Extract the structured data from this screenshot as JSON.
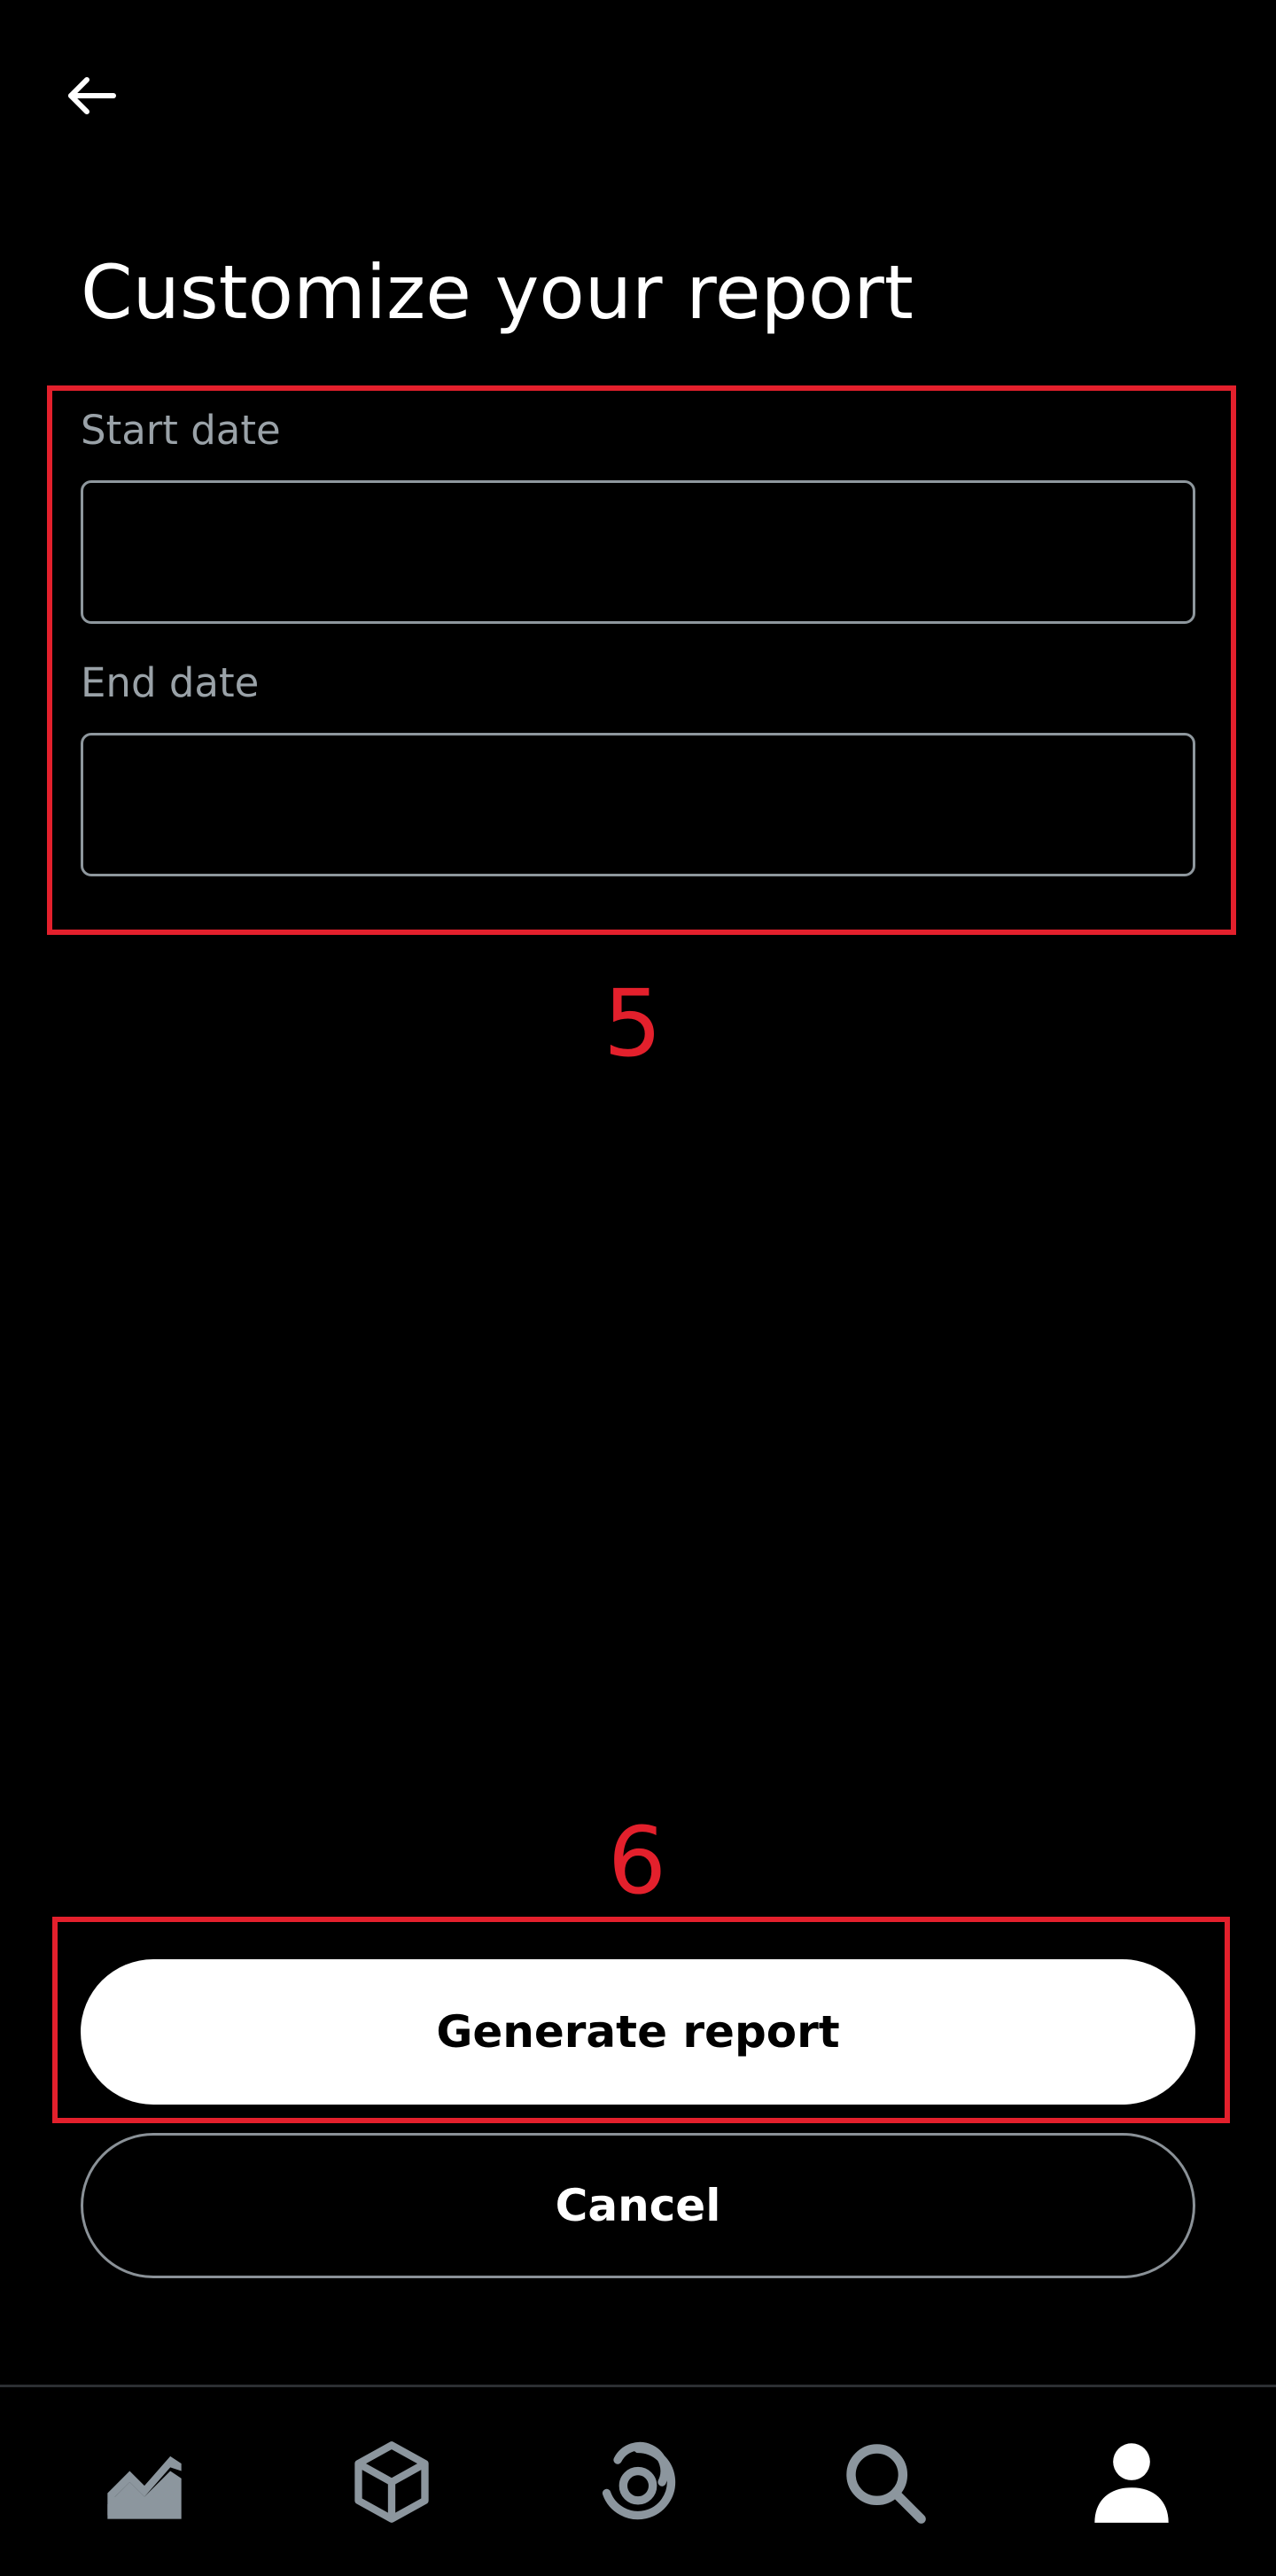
{
  "header": {
    "back_icon": "arrow-left-icon",
    "title": "Customize your report"
  },
  "form": {
    "start_date": {
      "label": "Start date",
      "value": ""
    },
    "end_date": {
      "label": "End date",
      "value": ""
    }
  },
  "actions": {
    "generate_label": "Generate report",
    "cancel_label": "Cancel"
  },
  "annotations": [
    {
      "number": "5",
      "target": "date-fields"
    },
    {
      "number": "6",
      "target": "generate-report-button"
    }
  ],
  "bottom_nav": {
    "items": [
      {
        "icon": "trend-chart-icon",
        "active": false
      },
      {
        "icon": "cube-icon",
        "active": false
      },
      {
        "icon": "swirl-icon",
        "active": false
      },
      {
        "icon": "search-icon",
        "active": false
      },
      {
        "icon": "profile-icon",
        "active": true
      }
    ]
  },
  "colors": {
    "background": "#000000",
    "text_primary": "#ffffff",
    "text_muted": "#9aa2a8",
    "input_border": "#8e979d",
    "annotation": "#e3202c",
    "icon_inactive": "#8c969e",
    "icon_active": "#ffffff"
  }
}
